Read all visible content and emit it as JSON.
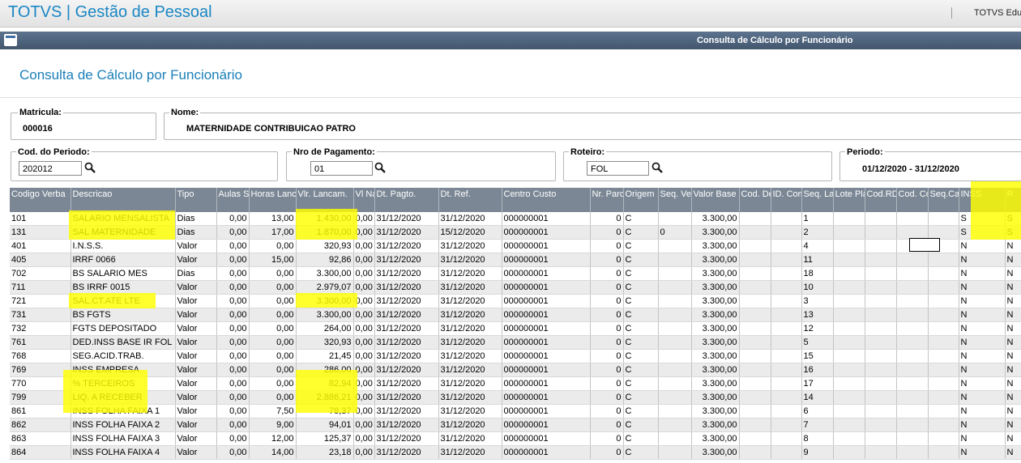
{
  "app": {
    "title": "TOTVS | Gestão de Pessoal",
    "user": "TOTVS Edu"
  },
  "window": {
    "title": "Consulta de Cálculo por Funcionário"
  },
  "page": {
    "title": "Consulta de Cálculo por Funcionário"
  },
  "form": {
    "matricula": {
      "label": "Matricula:",
      "value": "000016"
    },
    "nome": {
      "label": "Nome:",
      "value": "MATERNIDADE CONTRIBUICAO PATRO"
    },
    "periodo_cod": {
      "label": "Cod. do Periodo:",
      "value": "202012"
    },
    "nro_pagamento": {
      "label": "Nro de Pagamento:",
      "value": "01"
    },
    "roteiro": {
      "label": "Roteiro:",
      "value": "FOL"
    },
    "periodo": {
      "label": "Periodo:",
      "value": "01/12/2020 - 31/12/2020"
    }
  },
  "table": {
    "columns": [
      "Codigo Verba",
      "Descricao",
      "Tipo",
      "Aulas S",
      "Horas Lanc",
      "Vlr. Lancam.",
      "Vl Nao A",
      "Dt. Pagto.",
      "Dt. Ref.",
      "Centro Custo",
      "Nr. Parc",
      "Origem",
      "Seq. Ve",
      "Valor Base",
      "Cod. De",
      "ID. Com",
      "Seq. La",
      "Lote Pla",
      "Cod.RD.",
      "Cod. Co",
      "Seq.Cal",
      "INSS",
      "R"
    ],
    "rows": [
      [
        "101",
        "SALARIO MENSALISTA",
        "Dias",
        "0,00",
        "13,00",
        "1.430,00",
        "0,00",
        "31/12/2020",
        "31/12/2020",
        "000000001",
        "0",
        "C",
        "",
        "3.300,00",
        "",
        "",
        "1",
        "",
        "",
        "",
        "",
        "S",
        "S"
      ],
      [
        "131",
        "SAL MATERNIDADE",
        "Dias",
        "0,00",
        "17,00",
        "1.870,00",
        "0,00",
        "31/12/2020",
        "15/12/2020",
        "000000001",
        "0",
        "C",
        "0",
        "3.300,00",
        "",
        "",
        "2",
        "",
        "",
        "",
        "",
        "S",
        "S"
      ],
      [
        "401",
        "I.N.S.S.",
        "Valor",
        "0,00",
        "0,00",
        "320,93",
        "0,00",
        "31/12/2020",
        "31/12/2020",
        "000000001",
        "0",
        "C",
        "",
        "3.300,00",
        "",
        "",
        "4",
        "",
        "",
        "",
        "",
        "N",
        "N"
      ],
      [
        "405",
        "IRRF 0066",
        "Valor",
        "0,00",
        "15,00",
        "92,86",
        "0,00",
        "31/12/2020",
        "31/12/2020",
        "000000001",
        "0",
        "C",
        "",
        "3.300,00",
        "",
        "",
        "11",
        "",
        "",
        "",
        "",
        "N",
        "N"
      ],
      [
        "702",
        "BS SALARIO MES",
        "Dias",
        "0,00",
        "0,00",
        "3.300,00",
        "0,00",
        "31/12/2020",
        "31/12/2020",
        "000000001",
        "0",
        "C",
        "",
        "3.300,00",
        "",
        "",
        "18",
        "",
        "",
        "",
        "",
        "N",
        "N"
      ],
      [
        "711",
        "BS IRRF 0015",
        "Valor",
        "0,00",
        "0,00",
        "2.979,07",
        "0,00",
        "31/12/2020",
        "31/12/2020",
        "000000001",
        "0",
        "C",
        "",
        "3.300,00",
        "",
        "",
        "10",
        "",
        "",
        "",
        "",
        "N",
        "N"
      ],
      [
        "721",
        "SAL.CT.ATE LTE",
        "Valor",
        "0,00",
        "0,00",
        "3.300,00",
        "0,00",
        "31/12/2020",
        "31/12/2020",
        "000000001",
        "0",
        "C",
        "",
        "3.300,00",
        "",
        "",
        "3",
        "",
        "",
        "",
        "",
        "N",
        "N"
      ],
      [
        "731",
        "BS FGTS",
        "Valor",
        "0,00",
        "0,00",
        "3.300,00",
        "0,00",
        "31/12/2020",
        "31/12/2020",
        "000000001",
        "0",
        "C",
        "",
        "3.300,00",
        "",
        "",
        "13",
        "",
        "",
        "",
        "",
        "N",
        "N"
      ],
      [
        "732",
        "FGTS DEPOSITADO",
        "Valor",
        "0,00",
        "0,00",
        "264,00",
        "0,00",
        "31/12/2020",
        "31/12/2020",
        "000000001",
        "0",
        "C",
        "",
        "3.300,00",
        "",
        "",
        "12",
        "",
        "",
        "",
        "",
        "N",
        "N"
      ],
      [
        "761",
        "DED.INSS BASE IR FOL",
        "Valor",
        "0,00",
        "0,00",
        "320,93",
        "0,00",
        "31/12/2020",
        "31/12/2020",
        "000000001",
        "0",
        "C",
        "",
        "3.300,00",
        "",
        "",
        "5",
        "",
        "",
        "",
        "",
        "N",
        "N"
      ],
      [
        "768",
        "SEG.ACID.TRAB.",
        "Valor",
        "0,00",
        "0,00",
        "21,45",
        "0,00",
        "31/12/2020",
        "31/12/2020",
        "000000001",
        "0",
        "C",
        "",
        "3.300,00",
        "",
        "",
        "15",
        "",
        "",
        "",
        "",
        "N",
        "N"
      ],
      [
        "769",
        "INSS EMPRESA",
        "Valor",
        "0,00",
        "0,00",
        "286,00",
        "0,00",
        "31/12/2020",
        "31/12/2020",
        "000000001",
        "0",
        "C",
        "",
        "3.300,00",
        "",
        "",
        "16",
        "",
        "",
        "",
        "",
        "N",
        "N"
      ],
      [
        "770",
        "% TERCEIROS",
        "Valor",
        "0,00",
        "0,00",
        "82,94",
        "0,00",
        "31/12/2020",
        "31/12/2020",
        "000000001",
        "0",
        "C",
        "",
        "3.300,00",
        "",
        "",
        "17",
        "",
        "",
        "",
        "",
        "N",
        "N"
      ],
      [
        "799",
        "LIQ. A RECEBER",
        "Valor",
        "0,00",
        "0,00",
        "2.886,21",
        "0,00",
        "31/12/2020",
        "31/12/2020",
        "000000001",
        "0",
        "C",
        "",
        "3.300,00",
        "",
        "",
        "14",
        "",
        "",
        "",
        "",
        "N",
        "N"
      ],
      [
        "861",
        "INSS FOLHA FAIXA 1",
        "Valor",
        "0,00",
        "7,50",
        "78,37",
        "0,00",
        "31/12/2020",
        "31/12/2020",
        "000000001",
        "0",
        "C",
        "",
        "3.300,00",
        "",
        "",
        "6",
        "",
        "",
        "",
        "",
        "N",
        "N"
      ],
      [
        "862",
        "INSS FOLHA FAIXA 2",
        "Valor",
        "0,00",
        "9,00",
        "94,01",
        "0,00",
        "31/12/2020",
        "31/12/2020",
        "000000001",
        "0",
        "C",
        "",
        "3.300,00",
        "",
        "",
        "7",
        "",
        "",
        "",
        "",
        "N",
        "N"
      ],
      [
        "863",
        "INSS FOLHA FAIXA 3",
        "Valor",
        "0,00",
        "12,00",
        "125,37",
        "0,00",
        "31/12/2020",
        "31/12/2020",
        "000000001",
        "0",
        "C",
        "",
        "3.300,00",
        "",
        "",
        "8",
        "",
        "",
        "",
        "",
        "N",
        "N"
      ],
      [
        "864",
        "INSS FOLHA FAIXA 4",
        "Valor",
        "0,00",
        "14,00",
        "23,18",
        "0,00",
        "31/12/2020",
        "31/12/2020",
        "000000001",
        "0",
        "C",
        "",
        "3.300,00",
        "",
        "",
        "9",
        "",
        "",
        "",
        "",
        "N",
        "N"
      ]
    ]
  },
  "icons": {
    "search": "magnifier-icon",
    "window": "window-icon"
  },
  "colors": {
    "brand": "#1a87c4",
    "header": "#7b8795",
    "highlight": "#ffff00",
    "winbar": "#4d6077"
  }
}
